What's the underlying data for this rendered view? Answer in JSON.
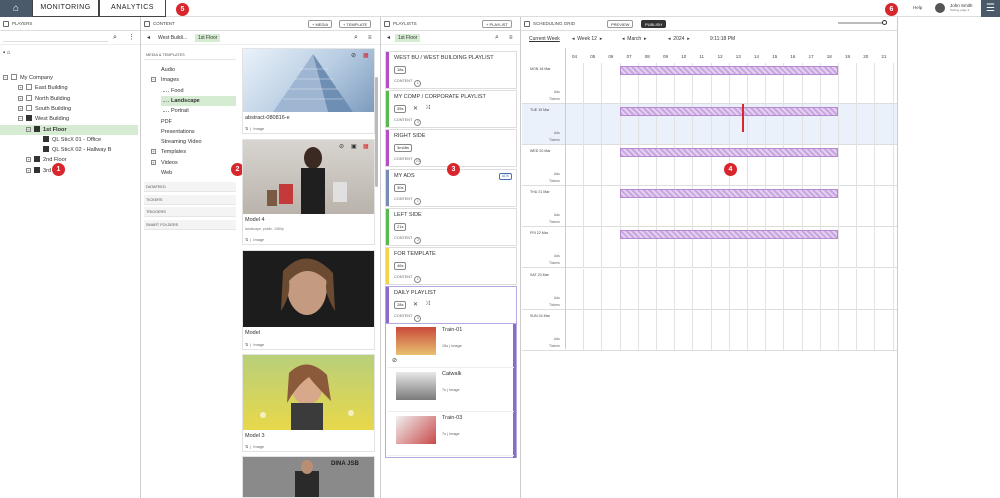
{
  "topnav": {
    "tabs": [
      "MONITORING",
      "ANALYTICS"
    ],
    "help": "Help",
    "user_name": "John Smith",
    "user_sub": "Setting page ▾"
  },
  "badges": [
    "1",
    "2",
    "3",
    "4",
    "5",
    "6"
  ],
  "players": {
    "title": "PLAYERS",
    "tree": [
      {
        "label": "My Company",
        "level": 1,
        "toggle": "−",
        "checked": false
      },
      {
        "label": "East Building",
        "level": 2,
        "toggle": "+",
        "checked": false
      },
      {
        "label": "North Building",
        "level": 2,
        "toggle": "+",
        "checked": false
      },
      {
        "label": "South Building",
        "level": 2,
        "toggle": "+",
        "checked": false
      },
      {
        "label": "West Building",
        "level": 2,
        "toggle": "−",
        "checked": true
      },
      {
        "label": "1st Floor",
        "level": 3,
        "toggle": "−",
        "checked": true,
        "selected": true
      },
      {
        "label": "QL SticX 01 - Office",
        "level": 4,
        "toggle": "",
        "checked": true
      },
      {
        "label": "QL SticX 02 - Hallway B",
        "level": 4,
        "toggle": "",
        "checked": true
      },
      {
        "label": "2nd Floor",
        "level": 3,
        "toggle": "+",
        "checked": true
      },
      {
        "label": "3rd Floor",
        "level": 3,
        "toggle": "+",
        "checked": true
      }
    ]
  },
  "content": {
    "title": "CONTENT",
    "add_media": "+ MEDIA",
    "add_template": "+ TEMPLATE",
    "breadcrumb": [
      "West Buildi...",
      "1st Floor"
    ],
    "section_media": "MEDIA & TEMPLATES",
    "library": [
      {
        "label": "Audio",
        "level": 1,
        "toggle": ""
      },
      {
        "label": "Images",
        "level": 1,
        "toggle": "−"
      },
      {
        "label": "Food",
        "level": 2,
        "toggle": ""
      },
      {
        "label": "Landscape",
        "level": 2,
        "toggle": "",
        "selected": true
      },
      {
        "label": "Portrait",
        "level": 2,
        "toggle": ""
      },
      {
        "label": "PDF",
        "level": 1,
        "toggle": ""
      },
      {
        "label": "Presentations",
        "level": 1,
        "toggle": ""
      },
      {
        "label": "Streaming Video",
        "level": 1,
        "toggle": ""
      },
      {
        "label": "Templates",
        "level": 1,
        "toggle": "+"
      },
      {
        "label": "Videos",
        "level": 1,
        "toggle": "+"
      },
      {
        "label": "Web",
        "level": 1,
        "toggle": ""
      }
    ],
    "sections": [
      "DATAFEED",
      "TICKERS",
      "TRIGGERS",
      "SMART FOLDERS"
    ],
    "assets": [
      {
        "title": "abstract-080816-e",
        "tags": "",
        "meta": "Image"
      },
      {
        "title": "Model 4",
        "tags": "landscape, public, 1080p",
        "meta": "Image"
      },
      {
        "title": "Model",
        "tags": "",
        "meta": "Image"
      },
      {
        "title": "Model 3",
        "tags": "",
        "meta": "Image"
      },
      {
        "title": "DINA JSB",
        "tags": "",
        "meta": ""
      }
    ]
  },
  "playlists": {
    "title": "PLAYLISTS",
    "add_playlist": "+ PLAYLIST",
    "breadcrumb": "1st Floor",
    "content_label": "CONTENT",
    "items": [
      {
        "name": "WEST BU /  WEST BUILDING PLAYLIST",
        "duration": "18s",
        "count": "1",
        "color": "#b24fc4"
      },
      {
        "name": "MY COMP /  CORPORATE PLAYLIST",
        "duration": "35s",
        "count": "3",
        "color": "#5ab94e"
      },
      {
        "name": "RIGHT SIDE",
        "duration": "3m48s",
        "count": "23",
        "color": "#b24fc4"
      },
      {
        "name": "MY ADS",
        "duration": "30s",
        "count": "1",
        "color": "#7a8bb5",
        "tag": "ADS"
      },
      {
        "name": "LEFT SIDE",
        "duration": "21s",
        "count": "3",
        "color": "#5ab94e"
      },
      {
        "name": "FOR TEMPLATE",
        "duration": "46s",
        "count": "1",
        "color": "#f2d34e"
      },
      {
        "name": "DAILY PLAYLIST",
        "duration": "28s",
        "count": "3",
        "color": "#8a6bc7"
      }
    ],
    "expanded_items": [
      {
        "name": "Train-01",
        "meta": "15s  |  Image"
      },
      {
        "name": "Catwalk",
        "meta": "7s  |  Image"
      },
      {
        "name": "Train-03",
        "meta": "7s  |  Image"
      }
    ]
  },
  "schedule": {
    "title": "SCHEDULING GRID",
    "preview": "PREVIEW",
    "publish": "PUBLISH",
    "current_week": "Current Week",
    "week": "Week 12",
    "month": "March",
    "year": "2024",
    "time": "9:11:18 PM",
    "hours": [
      "04",
      "05",
      "06",
      "07",
      "08",
      "09",
      "10",
      "11",
      "12",
      "13",
      "14",
      "15",
      "16",
      "17",
      "18",
      "19",
      "20",
      "21"
    ],
    "ads_label": "Ads",
    "tickers_label": "Tickers",
    "days": [
      {
        "label": "MON 18 Mar",
        "filled": true,
        "today": false
      },
      {
        "label": "TUE 19 Mar",
        "filled": true,
        "today": true
      },
      {
        "label": "WED 20 Mar",
        "filled": true,
        "today": false
      },
      {
        "label": "THU 21 Mar",
        "filled": true,
        "today": false
      },
      {
        "label": "FRI 22 Mar",
        "filled": true,
        "today": false
      },
      {
        "label": "SAT 23 Mar",
        "filled": false,
        "today": false
      },
      {
        "label": "SUN 24 Mar",
        "filled": false,
        "today": false
      }
    ],
    "accent": "#d9262c",
    "fill_color": "#c9a6e0"
  }
}
